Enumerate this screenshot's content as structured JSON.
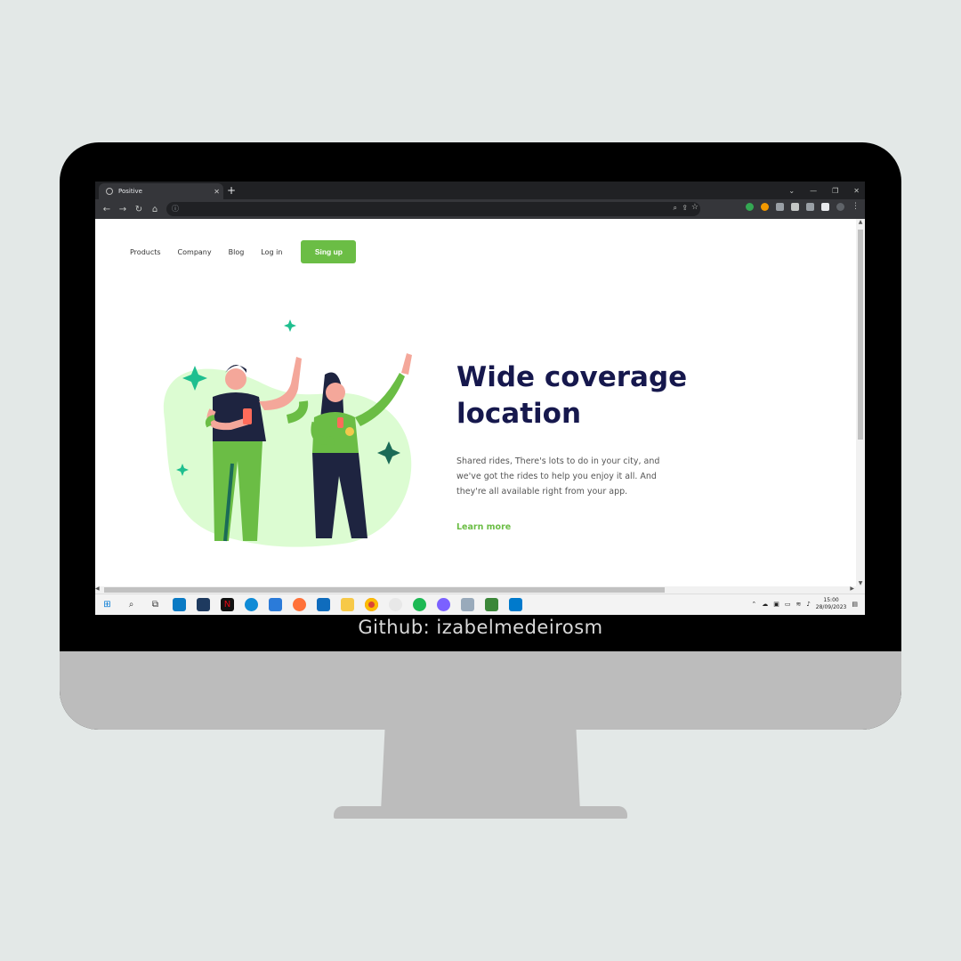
{
  "browser": {
    "tab_title": "Positive",
    "tab_close": "✕",
    "new_tab": "+",
    "window_controls": [
      "⌄",
      "—",
      "❐",
      "✕"
    ]
  },
  "site": {
    "nav": [
      "Products",
      "Company",
      "Blog",
      "Log in"
    ],
    "signup_label": "Sing up",
    "hero_title_line1": "Wide coverage",
    "hero_title_line2": "location",
    "hero_text": "Shared rides, There's lots to do in your city, and we've got the rides to help you enjoy it all. And they're all available right from your app.",
    "learn_more": "Learn more"
  },
  "taskbar": {
    "time": "15:00",
    "date": "28/09/2023"
  },
  "caption": "Github: izabelmedeirosm",
  "colors": {
    "accent": "#6bbd45",
    "title": "#16184d",
    "blob": "#dcfcd2"
  }
}
